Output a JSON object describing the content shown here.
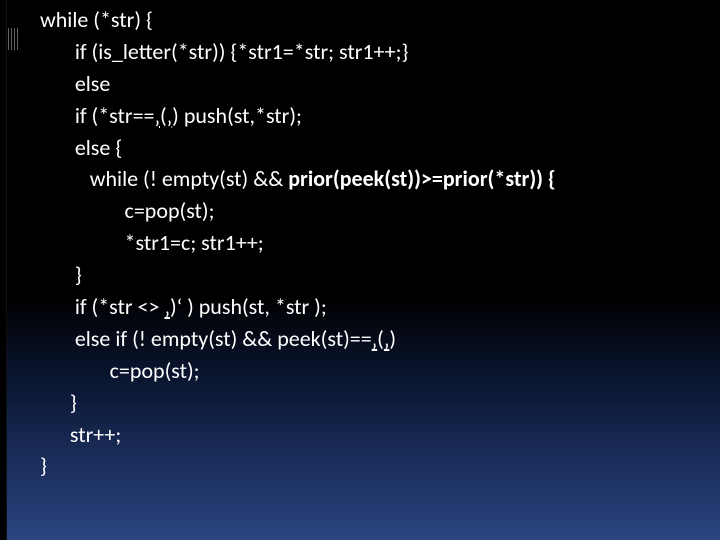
{
  "code": {
    "lines": [
      {
        "segments": [
          {
            "t": "while (*str) {"
          }
        ]
      },
      {
        "segments": [
          {
            "t": "       if (is_letter(*str)) {*str1=*str; str1++;}"
          }
        ]
      },
      {
        "segments": [
          {
            "t": "       else"
          }
        ]
      },
      {
        "segments": [
          {
            "t": "       if (*str=="
          },
          {
            "t": "‚",
            "u": true
          },
          {
            "t": "("
          },
          {
            "t": "‚",
            "u": true
          },
          {
            "t": ") push(st,*str);"
          }
        ]
      },
      {
        "segments": [
          {
            "t": "       else {"
          }
        ]
      },
      {
        "segments": [
          {
            "t": "          while (! empty(st) && "
          },
          {
            "t": "prior(peek(st))>=prior(*str)) {",
            "bold": true
          }
        ]
      },
      {
        "segments": [
          {
            "t": "                 c=pop(st);"
          }
        ]
      },
      {
        "segments": [
          {
            "t": "                 *str1=c; str1++;"
          }
        ]
      },
      {
        "segments": [
          {
            "t": "       }"
          }
        ]
      },
      {
        "segments": [
          {
            "t": "       if (*str <> "
          },
          {
            "t": "‚",
            "u": true
          },
          {
            "t": ")‘ ) push(st, *str );"
          }
        ]
      },
      {
        "segments": [
          {
            "t": "       else if (! empty(st) && peek(st)=="
          },
          {
            "t": "‚",
            "u": true
          },
          {
            "t": "("
          },
          {
            "t": "‚",
            "u": true
          },
          {
            "t": ")"
          }
        ]
      },
      {
        "segments": [
          {
            "t": "              c=pop(st);"
          }
        ]
      },
      {
        "segments": [
          {
            "t": "      }"
          }
        ]
      },
      {
        "segments": [
          {
            "t": "      str++;"
          }
        ]
      },
      {
        "segments": [
          {
            "t": "}"
          }
        ]
      }
    ]
  }
}
